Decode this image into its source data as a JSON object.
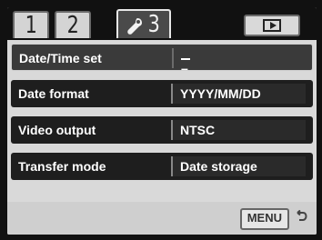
{
  "tabs": [
    {
      "label": "1"
    },
    {
      "label": "2"
    },
    {
      "label": "3",
      "icon": "wrench-icon"
    },
    {
      "label": "",
      "icon": "playback-icon"
    }
  ],
  "rows": [
    {
      "label": "Date/Time set",
      "value": "–"
    },
    {
      "label": "Date format",
      "value": "YYYY/MM/DD"
    },
    {
      "label": "Video output",
      "value": "NTSC"
    },
    {
      "label": "Transfer mode",
      "value": "Date storage"
    }
  ],
  "footer": {
    "menu_label": "MENU",
    "return_icon": "return-arrow-icon"
  },
  "colors": {
    "background": "#111111",
    "panel": "#d9d9d9",
    "row": "#1e1e1e",
    "text": "#ffffff"
  }
}
